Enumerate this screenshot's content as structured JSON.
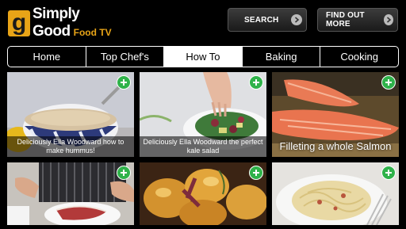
{
  "header": {
    "logo_letter": "g",
    "logo_line1": "Simply",
    "logo_line2": "Good",
    "logo_sub": "Food TV",
    "search_label": "SEARCH",
    "findout_label": "FIND OUT MORE"
  },
  "nav": {
    "tabs": [
      {
        "label": "Home"
      },
      {
        "label": "Top Chef's"
      },
      {
        "label": "How To"
      },
      {
        "label": "Baking"
      },
      {
        "label": "Cooking"
      }
    ],
    "active_index": 2
  },
  "tiles": [
    {
      "caption": "Deliciously Ella Woodward how to make hummus!"
    },
    {
      "caption": "Deliciously Ella Woodward the perfect kale salad"
    },
    {
      "caption": "Filleting a whole Salmon"
    },
    {
      "caption": ""
    },
    {
      "caption": ""
    },
    {
      "caption": ""
    }
  ],
  "colors": {
    "accent": "#e8a417",
    "add_button": "#2fb24a"
  }
}
